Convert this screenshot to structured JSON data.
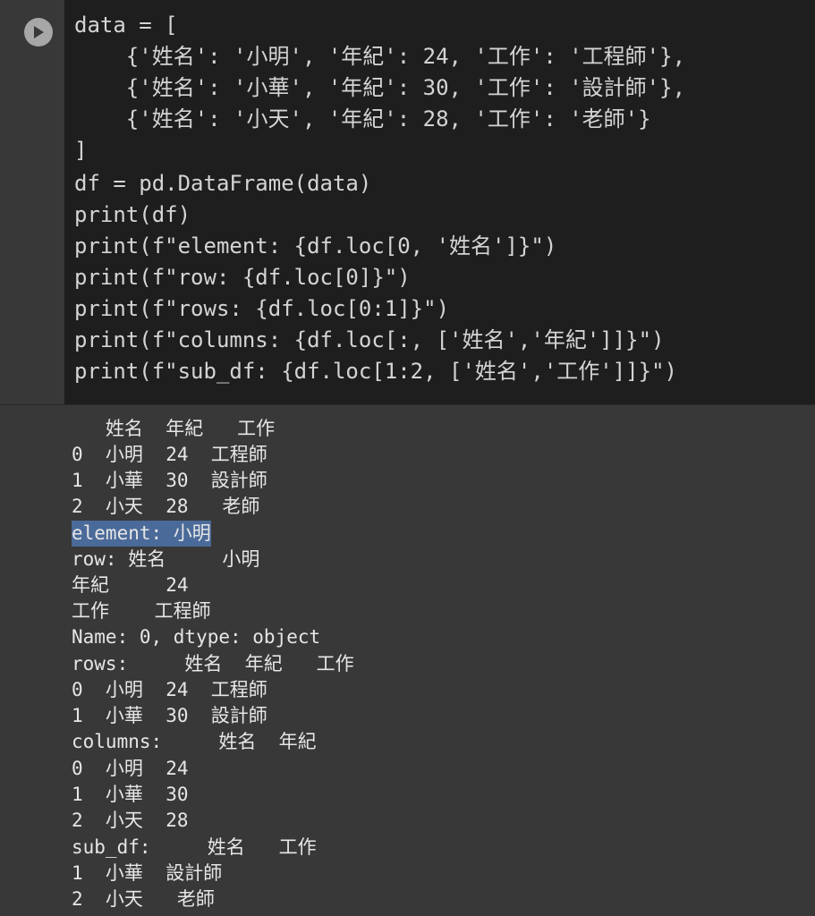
{
  "code_cell": {
    "run_button_icon": "play-icon",
    "lines": [
      "data = [",
      "    {'姓名': '小明', '年紀': 24, '工作': '工程師'},",
      "    {'姓名': '小華', '年紀': 30, '工作': '設計師'},",
      "    {'姓名': '小天', '年紀': 28, '工作': '老師'}",
      "]",
      "df = pd.DataFrame(data)",
      "print(df)",
      "print(f\"element: {df.loc[0, '姓名']}\")",
      "print(f\"row: {df.loc[0]}\")",
      "print(f\"rows: {df.loc[0:1]}\")",
      "print(f\"columns: {df.loc[:, ['姓名','年紀']]}\")",
      "print(f\"sub_df: {df.loc[1:2, ['姓名','工作']]}\")"
    ]
  },
  "output": {
    "lines": [
      "   姓名  年紀   工作",
      "0  小明  24  工程師",
      "1  小華  30  設計師",
      "2  小天  28   老師",
      "element: 小明",
      "row: 姓名     小明",
      "年紀     24",
      "工作    工程師",
      "Name: 0, dtype: object",
      "rows:     姓名  年紀   工作",
      "0  小明  24  工程師",
      "1  小華  30  設計師",
      "columns:     姓名  年紀",
      "0  小明  24",
      "1  小華  30",
      "2  小天  28",
      "sub_df:     姓名   工作",
      "1  小華  設計師",
      "2  小天   老師"
    ],
    "selected_line_index": 4
  },
  "colors": {
    "editor_bg": "#1e1e1e",
    "output_bg": "#383838",
    "selection": "#4a6a99"
  }
}
